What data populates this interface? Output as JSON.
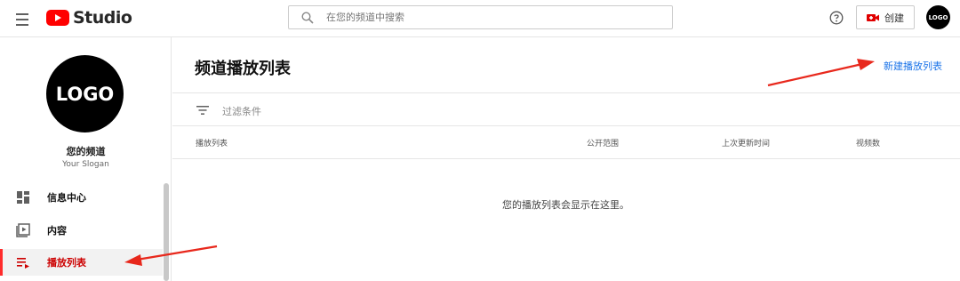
{
  "header": {
    "logo_text": "Studio",
    "search_placeholder": "在您的频道中搜索",
    "create_label": "创建",
    "avatar_text": "LOGO"
  },
  "sidebar": {
    "channel": {
      "avatar_text": "LOGO",
      "name": "您的频道",
      "slogan": "Your Slogan"
    },
    "items": [
      {
        "label": "信息中心",
        "icon": "dashboard-icon",
        "active": false
      },
      {
        "label": "内容",
        "icon": "content-icon",
        "active": false
      },
      {
        "label": "播放列表",
        "icon": "playlist-icon",
        "active": true
      }
    ]
  },
  "main": {
    "title": "频道播放列表",
    "new_playlist_label": "新建播放列表",
    "filter_label": "过滤条件",
    "columns": [
      "播放列表",
      "公开范围",
      "上次更新时间",
      "视频数"
    ],
    "empty_message": "您的播放列表会显示在这里。"
  },
  "colors": {
    "accent_red": "#ff0000",
    "link_blue": "#1a73e8",
    "annotation_arrow": "#e8281c"
  }
}
